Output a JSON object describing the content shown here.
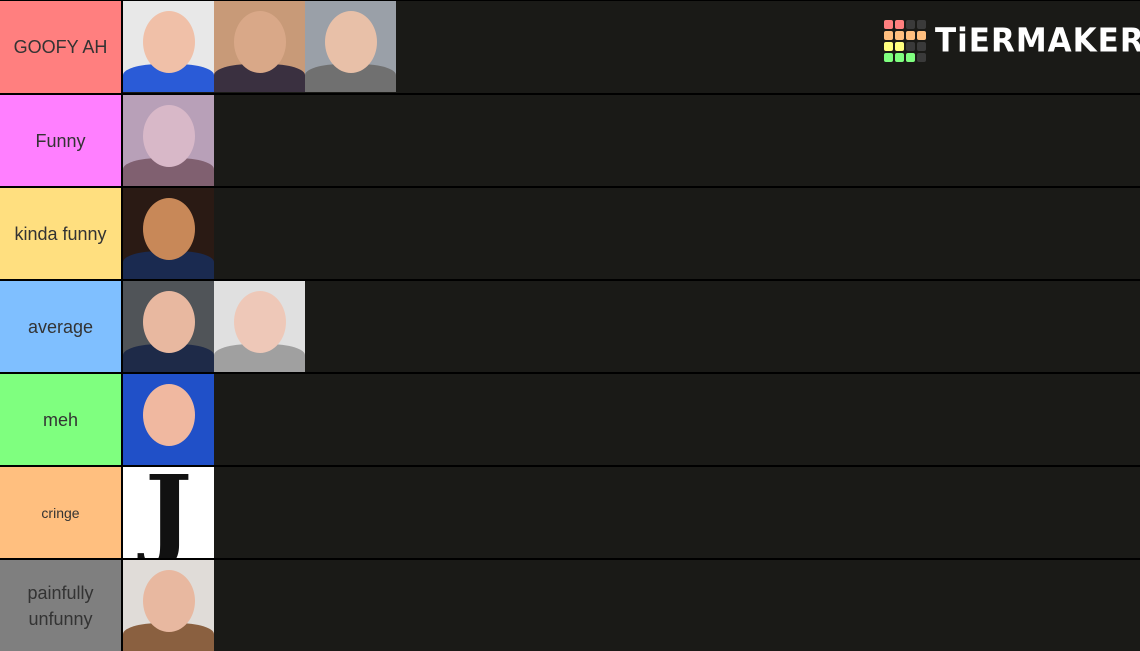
{
  "brand": {
    "name": "TiERMAKER",
    "grid_colors": [
      [
        "#ff7f7f",
        "#ff7f7f",
        "#3a3a3a",
        "#3a3a3a"
      ],
      [
        "#ffbf7f",
        "#ffbf7f",
        "#ffbf7f",
        "#ffbf7f"
      ],
      [
        "#ffff7f",
        "#ffff7f",
        "#3a3a3a",
        "#3a3a3a"
      ],
      [
        "#7fff7f",
        "#7fff7f",
        "#7fff7f",
        "#3a3a3a"
      ]
    ]
  },
  "tiers": [
    {
      "label": "GOOFY AH",
      "color": "#ff7f7f",
      "items": [
        {
          "alt": "bald person in blue hoodie",
          "bg": "#e8e8e8",
          "skin": "#f0c0a8",
          "shirt": "#2a5bd7"
        },
        {
          "alt": "pixelated face",
          "bg": "#c89a78",
          "skin": "#d9a888",
          "shirt": "#3a3040"
        },
        {
          "alt": "person with glasses shouting",
          "bg": "#9aa0a8",
          "skin": "#e8c0a8",
          "shirt": "#707070"
        }
      ]
    },
    {
      "label": "Funny",
      "color": "#ff7fff",
      "items": [
        {
          "alt": "close-up face",
          "bg": "#b8a0b8",
          "skin": "#d8b8c8",
          "shirt": "#806070"
        }
      ]
    },
    {
      "label": "kinda funny",
      "color": "#ffdf7f",
      "items": [
        {
          "alt": "smiling close-up face",
          "bg": "#2a1a14",
          "skin": "#c88858",
          "shirt": "#1a2a50"
        }
      ]
    },
    {
      "label": "average",
      "color": "#7fbfff",
      "items": [
        {
          "alt": "blond person",
          "bg": "#505458",
          "skin": "#e8b8a0",
          "shirt": "#1e2a48"
        },
        {
          "alt": "dark-haired person",
          "bg": "#e0e0e0",
          "skin": "#eec8b8",
          "shirt": "#a0a0a0"
        }
      ]
    },
    {
      "label": "meh",
      "color": "#7fff7f",
      "items": [
        {
          "alt": "person lying on blue",
          "bg": "#2050c8",
          "skin": "#f0b8a0",
          "shirt": "#2050c8"
        }
      ]
    },
    {
      "label": "cringe",
      "color": "#ffbf7f",
      "small": true,
      "items": [
        {
          "alt": "letter J",
          "letter": "J"
        }
      ]
    },
    {
      "label": "painfully unfunny",
      "color": "#7f7f7f",
      "items": [
        {
          "alt": "stretched face",
          "bg": "#e0dcd8",
          "skin": "#e8b8a0",
          "shirt": "#8a6040"
        }
      ]
    }
  ]
}
